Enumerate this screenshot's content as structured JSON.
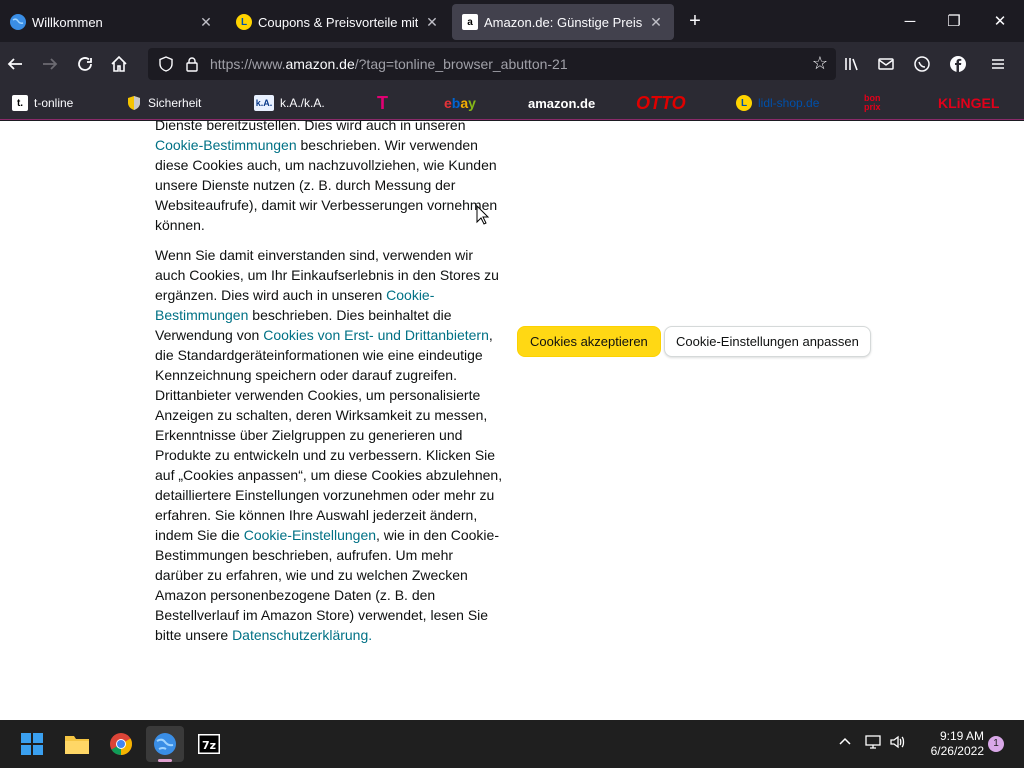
{
  "tabs": [
    {
      "title": "Willkommen",
      "favicon": "globe-icon"
    },
    {
      "title": "Coupons & Preisvorteile mit LIDL",
      "favicon": "lidl-icon"
    },
    {
      "title": "Amazon.de: Günstige Preise für",
      "favicon": "amazon-icon"
    }
  ],
  "navbar": {
    "url_prefix": "https://www.",
    "url_domain": "amazon.de",
    "url_rest": "/?tag=tonline_browser_abutton-21"
  },
  "bookmarks": [
    {
      "label": "t-online",
      "icon": "t-online-icon"
    },
    {
      "label": "Sicherheit",
      "icon": "shield-icon"
    },
    {
      "label": "k.A./k.A.",
      "icon": "ka-icon"
    },
    {
      "label": "T",
      "icon": "telekom-logo"
    },
    {
      "label": "ebay",
      "icon": "ebay-logo"
    },
    {
      "label": "amazon.de",
      "icon": "amazon-logo"
    },
    {
      "label": "OTTO",
      "icon": "otto-logo"
    },
    {
      "label": "lidl-shop.de",
      "icon": "lidl-icon"
    },
    {
      "label": "bonprix",
      "icon": "bonprix-logo"
    },
    {
      "label": "KLiNGEL",
      "icon": "klingel-logo"
    }
  ],
  "page": {
    "para1": {
      "t1": "Dienste bereitzustellen. Dies wird auch in unseren ",
      "link1": "Cookie-Bestimmungen",
      "t2": " beschrieben. Wir verwenden diese Cookies auch, um nachzuvollziehen, wie Kunden unsere Dienste nutzen (z. B. durch Messung der Websiteaufrufe), damit wir Verbesserungen vornehmen können."
    },
    "para2": {
      "t1": "Wenn Sie damit einverstanden sind, verwenden wir auch Cookies, um Ihr Einkaufserlebnis in den Stores zu ergänzen. Dies wird auch in unseren ",
      "link1": "Cookie-Bestimmungen",
      "t2": " beschrieben. Dies beinhaltet die Verwendung von ",
      "link2": "Cookies von Erst- und Drittanbietern",
      "t3": ", die Standardgeräteinformationen wie eine eindeutige Kennzeichnung speichern oder darauf zugreifen. Drittanbieter verwenden Cookies, um personalisierte Anzeigen zu schalten, deren Wirksamkeit zu messen, Erkenntnisse über Zielgruppen zu generieren und Produkte zu entwickeln und zu verbessern. Klicken Sie auf „Cookies anpassen“, um diese Cookies abzulehnen, detailliertere Einstellungen vorzunehmen oder mehr zu erfahren. Sie können Ihre Auswahl jederzeit ändern, indem Sie die ",
      "link3": "Cookie-Einstellungen",
      "t4": ", wie in den Cookie-Bestimmungen beschrieben, aufrufen. Um mehr darüber zu erfahren, wie und zu welchen Zwecken Amazon personenbezogene Daten (z. B. den Bestellverlauf im Amazon Store) verwendet, lesen Sie bitte unsere ",
      "link4": "Datenschutzerklärung",
      "t5": "."
    },
    "accept_button": "Cookies akzeptieren",
    "customize_button": "Cookie-Einstellungen anpassen"
  },
  "taskbar": {
    "time": "9:19 AM",
    "date": "6/26/2022",
    "notifications": "1"
  },
  "colors": {
    "accent_yellow": "#ffd814",
    "link": "#007185",
    "browser_dark": "#1c1b22"
  }
}
